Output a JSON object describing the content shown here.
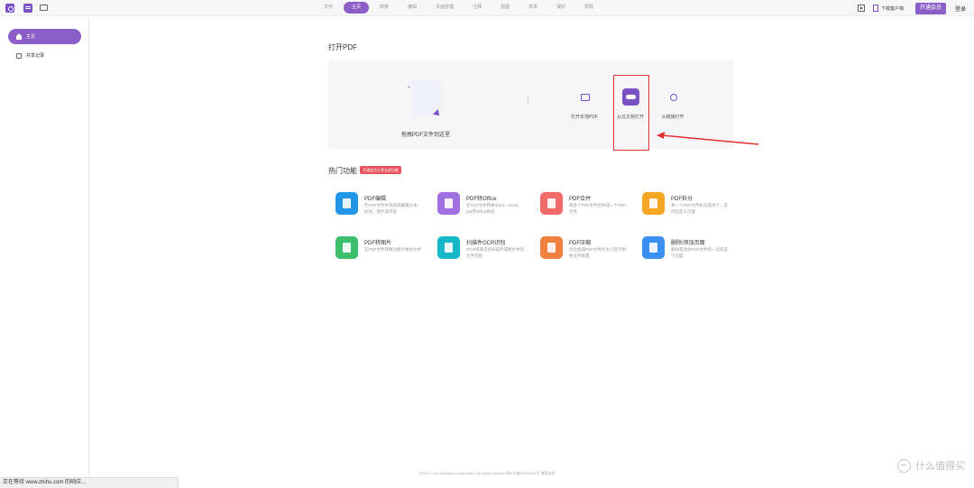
{
  "topbar": {
    "tabs": [
      {
        "label": "文件",
        "active": false
      },
      {
        "label": "主页",
        "active": true
      },
      {
        "label": "转换",
        "active": false
      },
      {
        "label": "编辑",
        "active": false
      },
      {
        "label": "页面管理",
        "active": false
      },
      {
        "label": "注释",
        "active": false
      },
      {
        "label": "视图",
        "active": false
      },
      {
        "label": "表单",
        "active": false
      },
      {
        "label": "保护",
        "active": false
      },
      {
        "label": "帮助",
        "active": false
      }
    ],
    "download_client": "下载客户端",
    "vip_button": "开通会员",
    "login": "登录"
  },
  "sidebar": {
    "items": [
      {
        "label": "主页",
        "icon": "home-icon",
        "active": true
      },
      {
        "label": "共享记录",
        "icon": "share-record-icon",
        "active": false
      }
    ]
  },
  "open_section": {
    "title": "打开PDF",
    "drop_label": "拖拽PDF文件到这里",
    "options": [
      {
        "label": "打开本地PDF",
        "icon": "monitor-icon"
      },
      {
        "label": "从云文档打开",
        "icon": "cloud-icon"
      },
      {
        "label": "从链接打开",
        "icon": "link-icon"
      }
    ]
  },
  "hot_section": {
    "title": "热门功能",
    "badge": "开通会员立享全部功能",
    "features": [
      {
        "title": "PDF编辑",
        "desc": "在PDF文件中添加或编辑文本、形状、图片等内容",
        "color": "#2196e6"
      },
      {
        "title": "PDF转Office",
        "desc": "在PDF文件转换Word、excel、ppt等Office格式",
        "color": "#a070e0"
      },
      {
        "title": "PDF合并",
        "desc": "将多个PDF文件合并成一个PDF文件",
        "color": "#f06a6a"
      },
      {
        "title": "PDF拆分",
        "desc": "将一个PDF文件拆分成多个，支持自定义页面",
        "color": "#f5a623"
      },
      {
        "title": "PDF转图片",
        "desc": "在PDF文件转换为图片格式文件",
        "color": "#3dbf6e"
      },
      {
        "title": "扫描件OCR识别",
        "desc": "OCR快速识别扫描件或图片中的文字内容",
        "color": "#16b8c8"
      },
      {
        "title": "PDF压缩",
        "desc": "优化缩减PDF文件的大小且不损失文件质量",
        "color": "#f08040"
      },
      {
        "title": "删除/添加页面",
        "desc": "删除或添加PDF文件的一页或多个页面",
        "color": "#3b8ff0"
      }
    ]
  },
  "footer": "©2024 Foxit Software Incorporated. All rights reserved.闽ICP备12013414号 增值电信",
  "status_text": "正在等待 www.zhihu.com 的响应...",
  "watermark": "什么值得买"
}
